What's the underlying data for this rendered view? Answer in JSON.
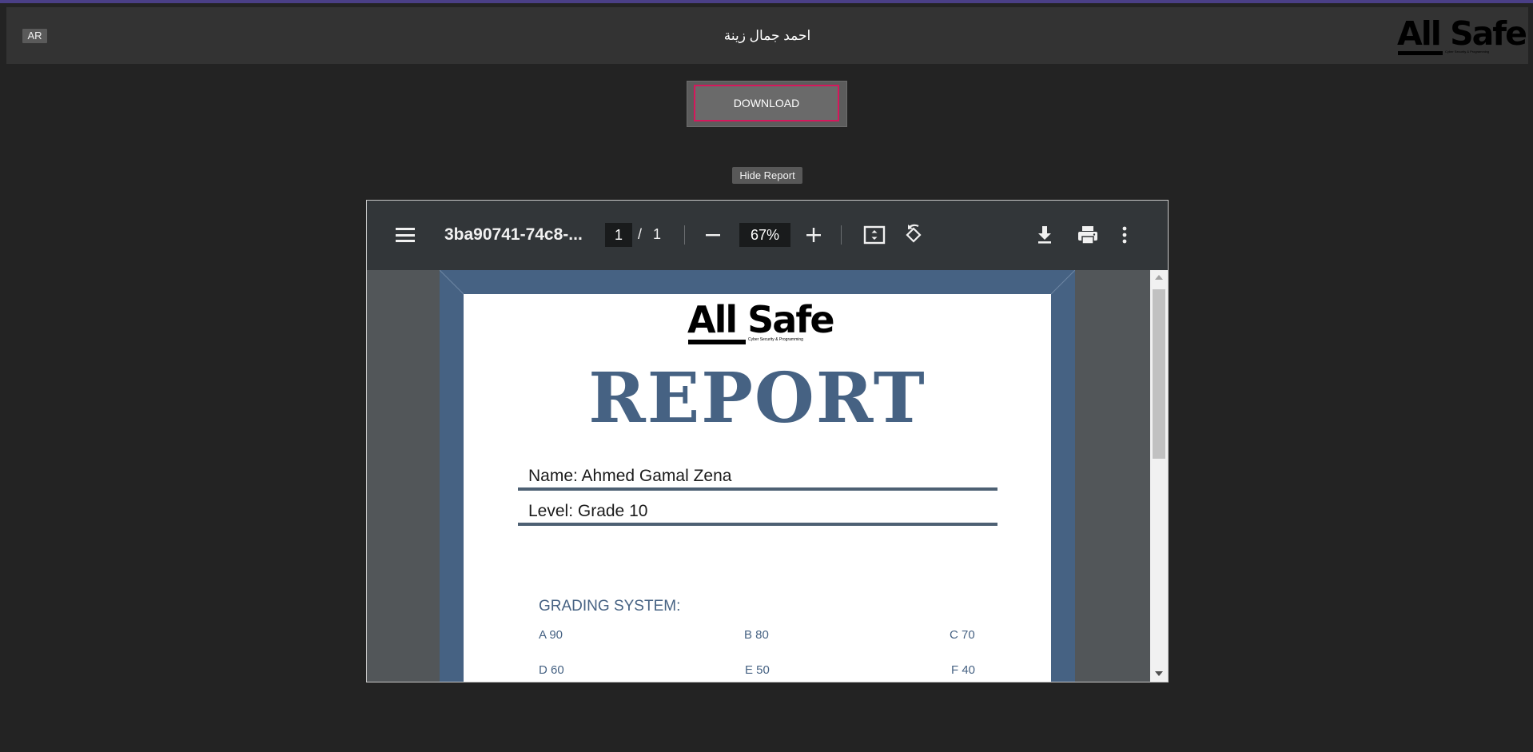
{
  "header": {
    "language_button": "AR",
    "user_name": "احمد جمال زينة",
    "brand": {
      "name": "All Safe",
      "tagline": "Cyber Security & Programming"
    }
  },
  "actions": {
    "download_label": "DOWNLOAD",
    "hide_report_label": "Hide Report"
  },
  "pdf_viewer": {
    "file_name": "3ba90741-74c8-...",
    "current_page": "1",
    "page_separator": "/",
    "total_pages": "1",
    "zoom": "67%",
    "toolbar_icons": [
      "menu-icon",
      "zoom-out-icon",
      "zoom-in-icon",
      "fit-page-icon",
      "rotate-icon",
      "download-icon",
      "print-icon",
      "more-options-icon"
    ]
  },
  "report": {
    "logo_name": "All Safe",
    "logo_tagline": "Cyber Security & Programming",
    "title": "REPORT",
    "name_field": "Name: Ahmed Gamal Zena",
    "level_field": "Level: Grade 10",
    "grading_title": "GRADING SYSTEM:",
    "grades": [
      "A 90",
      "B 80",
      "C 70",
      "D 60",
      "E 50",
      "F 40"
    ]
  },
  "colors": {
    "background": "#232323",
    "header": "#333333",
    "download_border": "#d6175c",
    "report_blue": "#466283",
    "viewer_toolbar": "#323639"
  }
}
